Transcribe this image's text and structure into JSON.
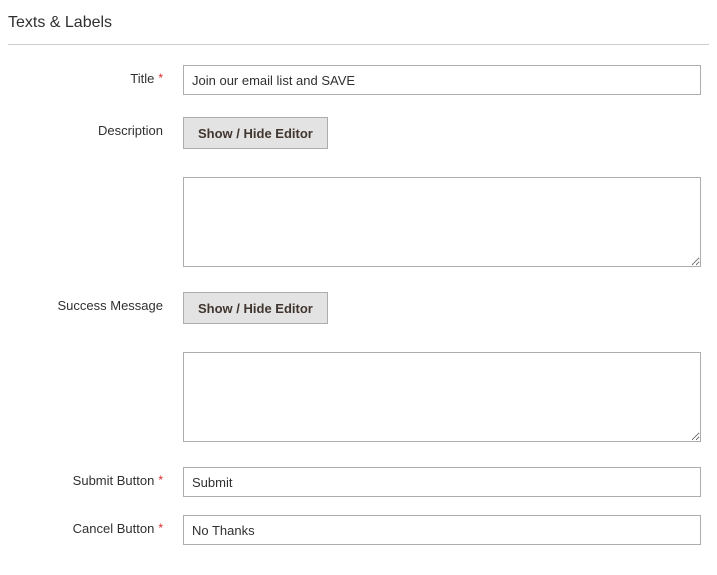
{
  "section": {
    "heading": "Texts & Labels"
  },
  "labels": {
    "title": "Title",
    "description": "Description",
    "success_message": "Success Message",
    "submit_button": "Submit Button",
    "cancel_button": "Cancel Button"
  },
  "buttons": {
    "toggle_editor": "Show / Hide Editor"
  },
  "values": {
    "title": "Join our email list and SAVE",
    "description": "",
    "success_message": "",
    "submit_button": "Submit",
    "cancel_button": "No Thanks"
  },
  "required_mark": "*"
}
